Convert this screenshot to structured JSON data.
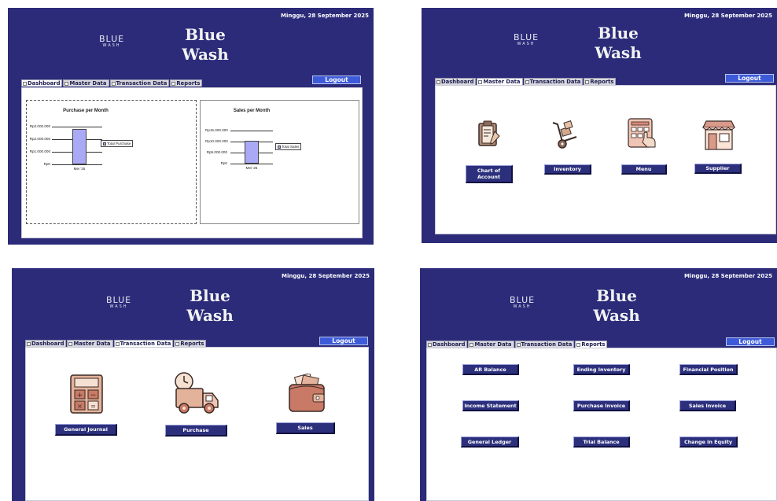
{
  "app": {
    "date": "Minggu, 28 September 2025",
    "logo_text": "BLUE",
    "logo_sub": "WASH",
    "title_line1": "Blue",
    "title_line2": "Wash",
    "logout": "Logout"
  },
  "tabs": [
    "Dashboard",
    "Master Data",
    "Transaction Data",
    "Reports"
  ],
  "colors": {
    "header_bg": "#2b2b7a",
    "button_bg": "#2b2f7c",
    "bar_fill": "#a9a9f5"
  },
  "dashboard": {
    "chart_data": [
      {
        "type": "bar",
        "title": "Purchase per Month",
        "categories": [
          "Mei '25"
        ],
        "series": [
          {
            "name": "Total Purchase",
            "values": [
              2800000
            ]
          }
        ],
        "yticks": [
          "Rp3.000.000",
          "Rp2.000.000",
          "Rp1.000.000",
          "Rp0"
        ],
        "ylim": [
          0,
          3000000
        ],
        "legend": "right"
      },
      {
        "type": "bar",
        "title": "Sales per Month",
        "categories": [
          "Mei '25"
        ],
        "series": [
          {
            "name": "Total Sales",
            "values": [
              10500000
            ]
          }
        ],
        "yticks": [
          "Rp15.000.000",
          "Rp10.000.000",
          "Rp5.000.000",
          "Rp0"
        ],
        "ylim": [
          0,
          15000000
        ],
        "legend": "right"
      }
    ]
  },
  "master": {
    "buttons": [
      "Chart of Account",
      "Inventory",
      "Menu",
      "Supplier"
    ],
    "icons": [
      "clipboard-icon",
      "hand-truck-icon",
      "menu-tablet-icon",
      "store-icon"
    ]
  },
  "transaction": {
    "buttons": [
      "General Journal",
      "Purchase",
      "Sales"
    ],
    "icons": [
      "calculator-icon",
      "delivery-truck-icon",
      "wallet-icon"
    ]
  },
  "reports": {
    "buttons": [
      "AR Balance",
      "Ending Inventory",
      "Financial Position",
      "Income Statement",
      "Purchase Invoice",
      "Sales Invoice",
      "General Ledger",
      "Trial Balance",
      "Change in Equity"
    ]
  }
}
